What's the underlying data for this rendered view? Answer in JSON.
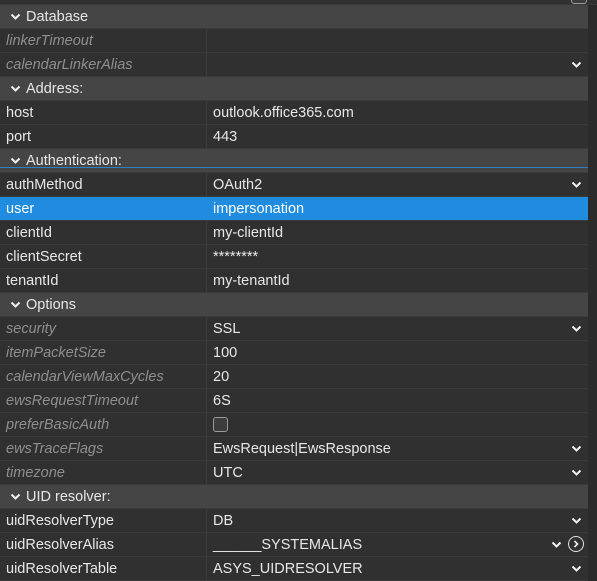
{
  "sections": [
    {
      "title": "Database",
      "rows": [
        {
          "name": "linkerTimeout",
          "value": "",
          "muted": true
        },
        {
          "name": "calendarLinkerAlias",
          "value": "",
          "muted": true,
          "dropdown": true
        }
      ]
    },
    {
      "title": "Address:",
      "rows": [
        {
          "name": "host",
          "value": "outlook.office365.com"
        },
        {
          "name": "port",
          "value": "443"
        }
      ]
    },
    {
      "title": "Authentication:",
      "rows": [
        {
          "name": "authMethod",
          "value": "OAuth2",
          "dropdown": true
        },
        {
          "name": "user",
          "value": "impersonation",
          "selected": true
        },
        {
          "name": "clientId",
          "value": "my-clientId"
        },
        {
          "name": "clientSecret",
          "value": "********"
        },
        {
          "name": "tenantId",
          "value": "my-tenantId"
        }
      ]
    },
    {
      "title": "Options",
      "rows": [
        {
          "name": "security",
          "value": "SSL",
          "muted": true,
          "dropdown": true
        },
        {
          "name": "itemPacketSize",
          "value": "100",
          "muted": true
        },
        {
          "name": "calendarViewMaxCycles",
          "value": "20",
          "muted": true
        },
        {
          "name": "ewsRequestTimeout",
          "value": "6S",
          "muted": true
        },
        {
          "name": "preferBasicAuth",
          "value": "",
          "muted": true,
          "checkbox": true
        },
        {
          "name": "ewsTraceFlags",
          "value": "EwsRequest|EwsResponse",
          "muted": true,
          "dropdown": true
        },
        {
          "name": "timezone",
          "value": "UTC",
          "muted": true,
          "dropdown": true
        }
      ]
    },
    {
      "title": "UID resolver:",
      "rows": [
        {
          "name": "uidResolverType",
          "value": "DB",
          "dropdown": true
        },
        {
          "name": "uidResolverAlias",
          "value": "______SYSTEMALIAS",
          "dropdown": true,
          "goto": true
        },
        {
          "name": "uidResolverTable",
          "value": "ASYS_UIDRESOLVER",
          "dropdown": true
        }
      ]
    }
  ],
  "icons": {
    "expand": "chevron-down-icon",
    "dropdown": "chevron-down-icon",
    "goto": "arrow-right-circle-icon"
  },
  "colors": {
    "background": "#303030",
    "section": "#454545",
    "selected": "#1f8ce0",
    "muted_text": "#8f8f8f"
  }
}
